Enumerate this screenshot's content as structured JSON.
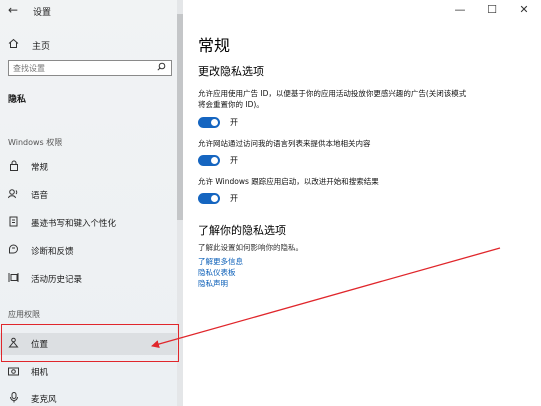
{
  "window": {
    "title": "设置",
    "minimize": "—",
    "maximize": "☐",
    "close": "✕",
    "back": "←"
  },
  "sidebar": {
    "home": "主页",
    "search_placeholder": "查找设置",
    "section": "隐私",
    "windows_group": "Windows 权限",
    "windows_items": [
      {
        "label": "常规",
        "icon": "lock-icon"
      },
      {
        "label": "语音",
        "icon": "speech-icon"
      },
      {
        "label": "墨迹书写和键入个性化",
        "icon": "pen-icon"
      },
      {
        "label": "诊断和反馈",
        "icon": "feedback-icon"
      },
      {
        "label": "活动历史记录",
        "icon": "timeline-icon"
      }
    ],
    "app_group": "应用权限",
    "app_items": [
      {
        "label": "位置",
        "icon": "location-icon",
        "selected": true
      },
      {
        "label": "相机",
        "icon": "camera-icon"
      },
      {
        "label": "麦克风",
        "icon": "microphone-icon"
      }
    ]
  },
  "main": {
    "title": "常规",
    "section_title": "更改隐私选项",
    "options": [
      {
        "text": "允许应用使用广告 ID，以便基于你的应用活动投放你更感兴趣的广告(关闭该模式将会重置你的 ID)。",
        "state": "开",
        "on": true
      },
      {
        "text": "允许网站通过访问我的语言列表来提供本地相关内容",
        "state": "开",
        "on": true
      },
      {
        "text": "允许 Windows 跟踪应用启动，以改进开始和搜索结果",
        "state": "开",
        "on": true
      }
    ],
    "know_title": "了解你的隐私选项",
    "know_desc": "了解此设置如何影响你的隐私。",
    "links": [
      "了解更多信息",
      "隐私仪表板",
      "隐私声明"
    ]
  },
  "annotation": {
    "color": "#e0262b"
  }
}
